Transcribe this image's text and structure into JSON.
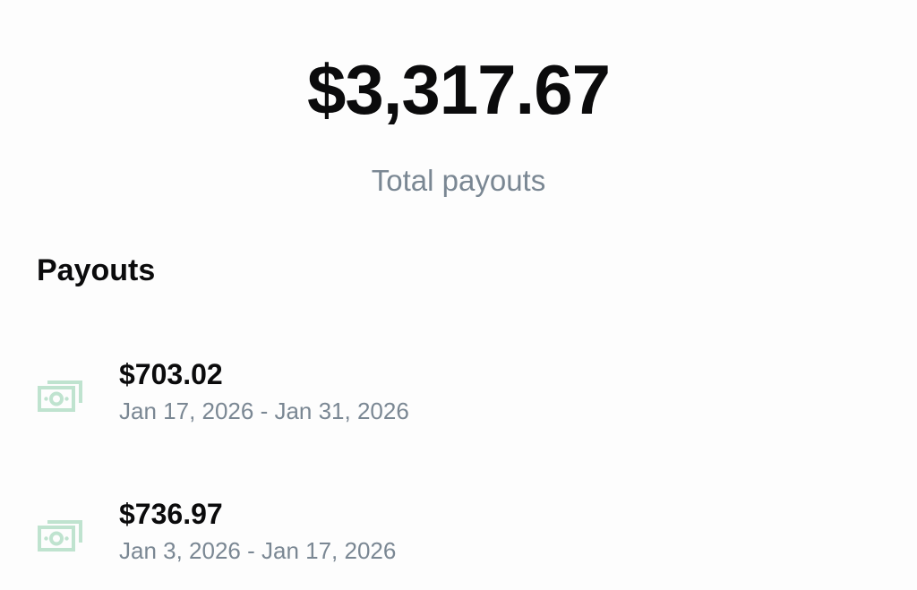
{
  "summary": {
    "total_amount": "$3,317.67",
    "total_label": "Total payouts"
  },
  "payouts_section": {
    "title": "Payouts",
    "items": [
      {
        "icon": "cash-icon",
        "amount": "$703.02",
        "period": "Jan 17, 2026 - Jan 31, 2026"
      },
      {
        "icon": "cash-icon",
        "amount": "$736.97",
        "period": "Jan 3, 2026 - Jan 17, 2026"
      }
    ]
  },
  "colors": {
    "primary_text": "#0b0b0c",
    "secondary_text": "#7a8793",
    "icon_green": "#bfe3cf",
    "background": "#fdfdfd"
  }
}
